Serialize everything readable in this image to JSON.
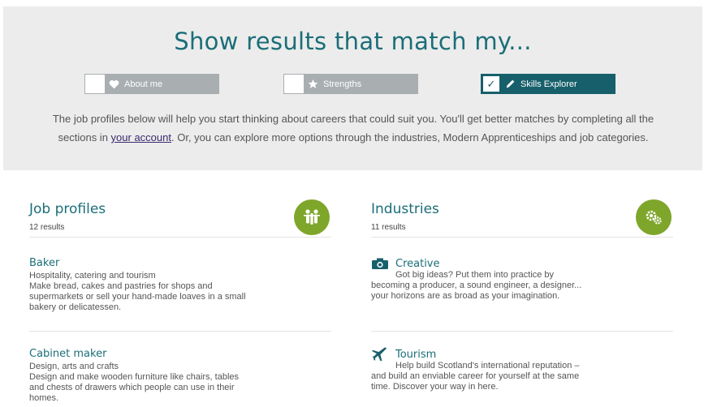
{
  "headline": "Show results that match my...",
  "filters": [
    {
      "label": "About me",
      "checked": false,
      "icon": "heart-icon"
    },
    {
      "label": "Strengths",
      "checked": false,
      "icon": "star-icon"
    },
    {
      "label": "Skills Explorer",
      "checked": true,
      "icon": "pencil-icon"
    }
  ],
  "intro": {
    "before": "The job profiles below will help you start thinking about careers that could suit you. You'll get better matches by completing all the sections in ",
    "link": "your account",
    "after": ". Or, you can explore more options through the industries, Modern Apprenticeships and job categories."
  },
  "job_profiles": {
    "title": "Job profiles",
    "count": "12 results",
    "icon": "people-icon",
    "items": [
      {
        "title": "Baker",
        "sector": "Hospitality, catering and tourism",
        "description": "Make bread, cakes and pastries for shops and supermarkets or sell your hand-made loaves in a small bakery or delicatessen."
      },
      {
        "title": "Cabinet maker",
        "sector": "Design, arts and crafts",
        "description": "Design and make wooden furniture like chairs, tables and chests of drawers which people can use in their homes."
      }
    ]
  },
  "industries": {
    "title": "Industries",
    "count": "11 results",
    "icon": "gears-icon",
    "items": [
      {
        "title": "Creative",
        "icon": "camera-icon",
        "description": "Got big ideas? Put them into practice by becoming a producer, a sound engineer, a designer... your horizons are as broad as your imagination."
      },
      {
        "title": "Tourism",
        "icon": "plane-icon",
        "description": "Help build Scotland's international reputation – and build an enviable career for yourself at the same time. Discover your way in here."
      }
    ]
  },
  "colors": {
    "teal": "#1b6e78",
    "active_filter": "#17606b",
    "inactive_filter": "#a9aeb1",
    "badge_green": "#7ea62b",
    "panel_bg": "#ececec"
  }
}
